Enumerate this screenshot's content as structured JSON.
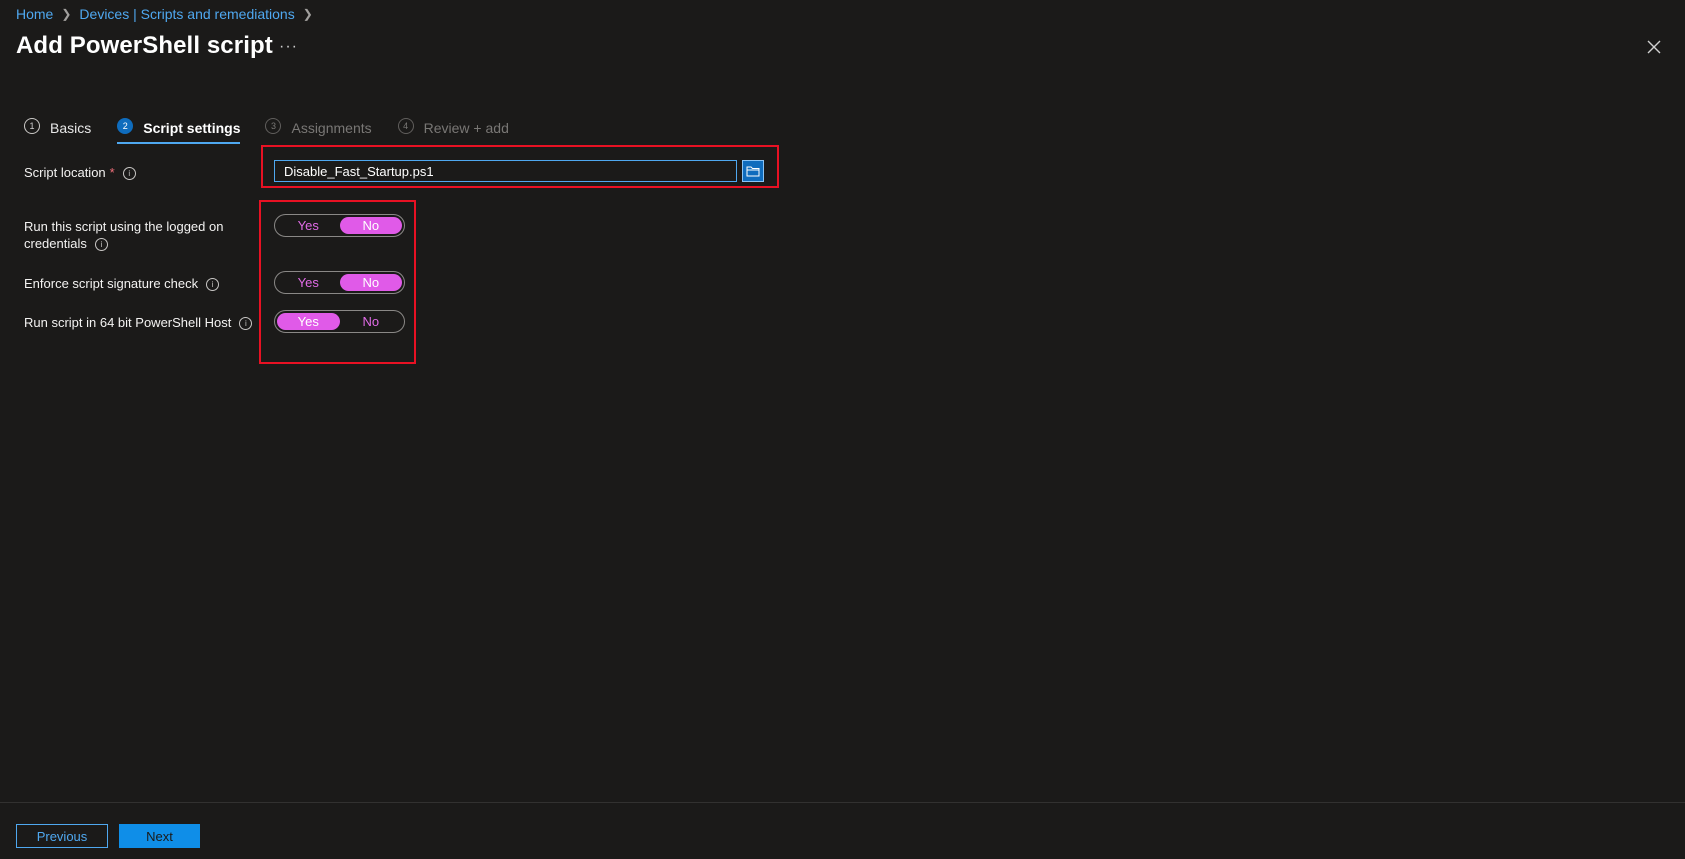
{
  "breadcrumb": {
    "home": "Home",
    "devices": "Devices | Scripts and remediations"
  },
  "page": {
    "title": "Add PowerShell script",
    "more": "···"
  },
  "steps": [
    {
      "num": "1",
      "label": "Basics",
      "state": "done"
    },
    {
      "num": "2",
      "label": "Script settings",
      "state": "active"
    },
    {
      "num": "3",
      "label": "Assignments",
      "state": "disabled"
    },
    {
      "num": "4",
      "label": "Review + add",
      "state": "disabled"
    }
  ],
  "script_location": {
    "label": "Script location",
    "required_mark": "*",
    "value": "Disable_Fast_Startup.ps1",
    "browse_icon": "folder-icon"
  },
  "settings": [
    {
      "label_line1": "Run this script using the logged on",
      "label_line2": "credentials",
      "yes": "Yes",
      "no": "No",
      "selected": "No"
    },
    {
      "label_line1": "Enforce script signature check",
      "yes": "Yes",
      "no": "No",
      "selected": "No"
    },
    {
      "label_line1": "Run script in 64 bit PowerShell Host",
      "yes": "Yes",
      "no": "No",
      "selected": "Yes"
    }
  ],
  "info_glyph": "i",
  "footer": {
    "previous": "Previous",
    "next": "Next"
  },
  "colors": {
    "background": "#1b1a19",
    "link": "#4fa8f0",
    "toggle_on": "#e05ae8",
    "highlight": "#e81123",
    "primary": "#0f8ee8"
  }
}
